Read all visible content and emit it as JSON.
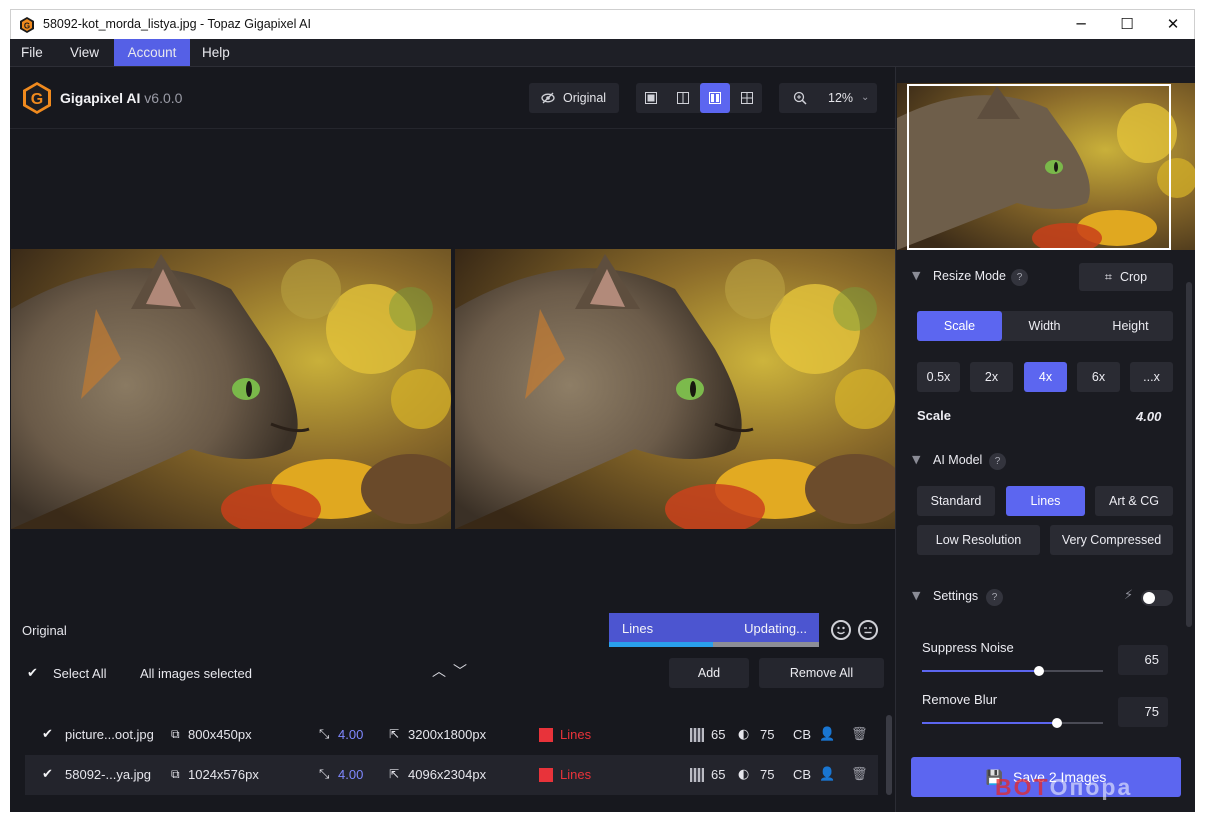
{
  "window": {
    "title": "58092-kot_morda_listya.jpg - Topaz Gigapixel AI",
    "minimize": "─",
    "maximize": "☐",
    "close": "✕"
  },
  "menu": [
    "File",
    "View",
    "Account",
    "Help"
  ],
  "app": {
    "name": "Gigapixel AI",
    "version": "v6.0.0"
  },
  "toolbar": {
    "original_label": "Original",
    "zoom": "12%"
  },
  "preview": {
    "original_label": "Original",
    "model": "Lines",
    "status": "Updating...",
    "progress": 0.5
  },
  "list": {
    "select_all": "Select All",
    "all_selected": "All images selected",
    "add": "Add",
    "remove_all": "Remove All",
    "rows": [
      {
        "name": "picture...oot.jpg",
        "size": "800x450px",
        "scale": "4.00",
        "output": "3200x1800px",
        "model": "Lines",
        "noise": "65",
        "blur": "75",
        "cb": "CB"
      },
      {
        "name": "58092-...ya.jpg",
        "size": "1024x576px",
        "scale": "4.00",
        "output": "4096x2304px",
        "model": "Lines",
        "noise": "65",
        "blur": "75",
        "cb": "CB"
      }
    ]
  },
  "panel": {
    "resize_mode": "Resize Mode",
    "help": "?",
    "crop": "Crop",
    "modes": [
      "Scale",
      "Width",
      "Height"
    ],
    "scales": [
      "0.5x",
      "2x",
      "4x",
      "6x",
      "...x"
    ],
    "scale_label": "Scale",
    "scale_value": "4.00",
    "ai_model": "AI Model",
    "models": [
      "Standard",
      "Lines",
      "Art & CG",
      "Low Resolution",
      "Very Compressed"
    ],
    "settings": "Settings",
    "suppress_noise": "Suppress Noise",
    "suppress_noise_value": "65",
    "remove_blur": "Remove Blur",
    "remove_blur_value": "75",
    "save": "Save 2 Images"
  },
  "watermark": {
    "part1": "BOT",
    "part2": "Опора"
  }
}
